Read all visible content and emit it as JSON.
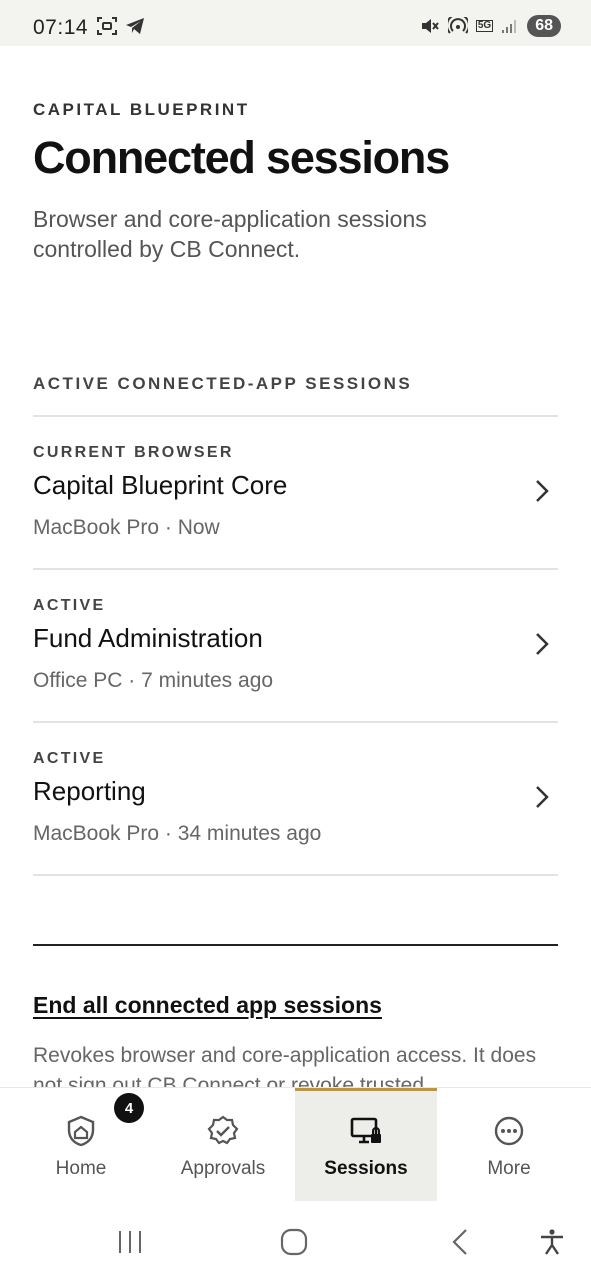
{
  "status_bar": {
    "time": "07:14",
    "battery": "68",
    "network": "5G"
  },
  "header": {
    "brand": "CAPITAL BLUEPRINT",
    "title": "Connected sessions",
    "subtitle": "Browser and core-application sessions controlled by CB Connect."
  },
  "section_title": "ACTIVE CONNECTED-APP SESSIONS",
  "sessions": [
    {
      "status": "CURRENT BROWSER",
      "name": "Capital Blueprint Core",
      "meta": "MacBook Pro · Now"
    },
    {
      "status": "ACTIVE",
      "name": "Fund Administration",
      "meta": "Office PC · 7 minutes ago"
    },
    {
      "status": "ACTIVE",
      "name": "Reporting",
      "meta": "MacBook Pro · 34 minutes ago"
    }
  ],
  "end_all": {
    "link": "End all connected app sessions",
    "description": "Revokes browser and core-application access. It does not sign out CB Connect or revoke trusted"
  },
  "bottom_nav": {
    "home": "Home",
    "home_badge": "4",
    "approvals": "Approvals",
    "sessions": "Sessions",
    "more": "More",
    "active": "sessions",
    "accent": "#b99645"
  }
}
